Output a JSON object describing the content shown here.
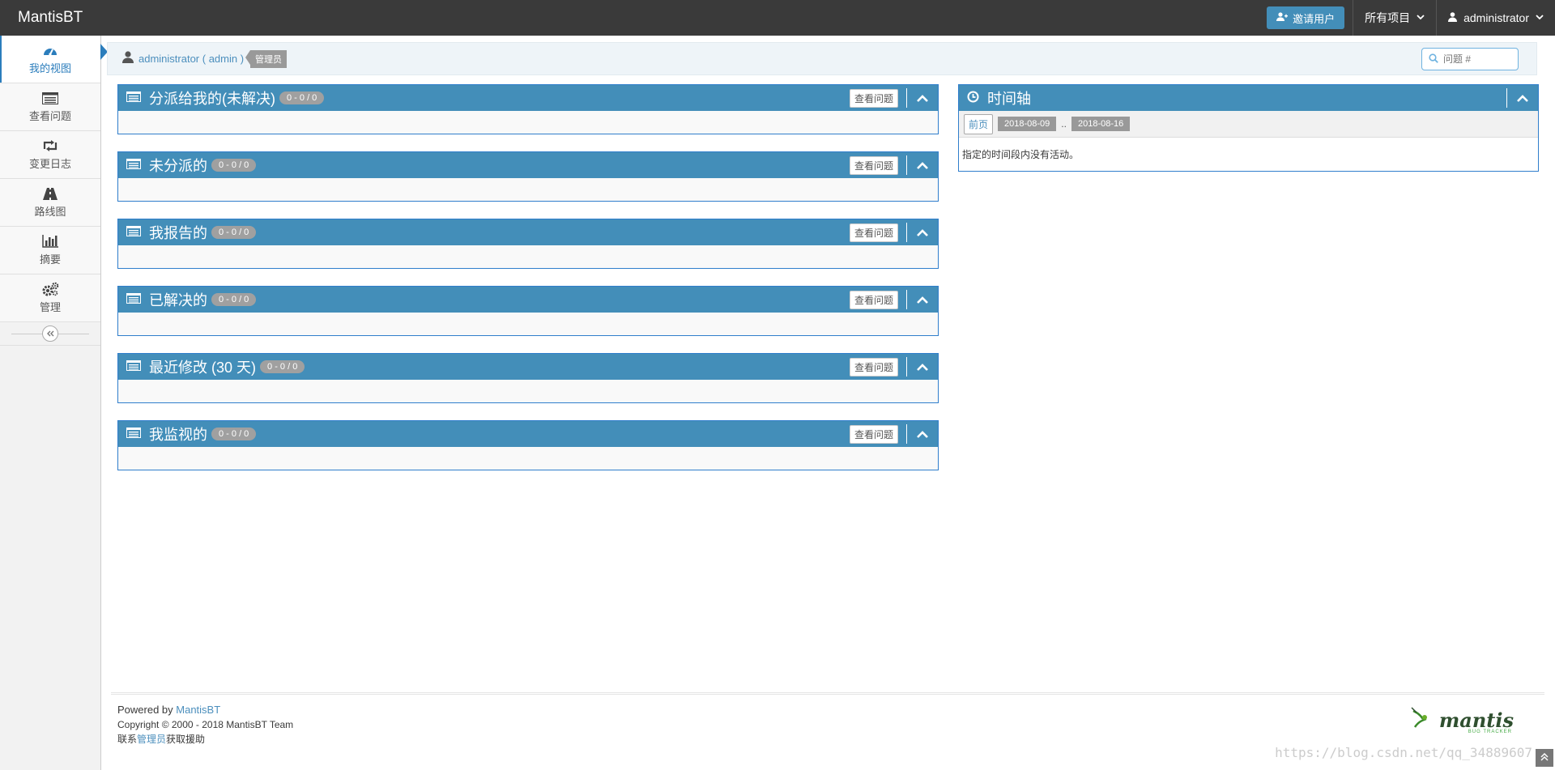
{
  "navbar": {
    "brand": "MantisBT",
    "invite_label": "邀请用户",
    "projects_label": "所有项目",
    "user_label": "administrator"
  },
  "sidebar": {
    "items": [
      {
        "label": "我的视图",
        "icon": "dashboard-icon"
      },
      {
        "label": "查看问题",
        "icon": "list-icon"
      },
      {
        "label": "变更日志",
        "icon": "retweet-icon"
      },
      {
        "label": "路线图",
        "icon": "road-icon"
      },
      {
        "label": "摘要",
        "icon": "bar-chart-icon"
      },
      {
        "label": "管理",
        "icon": "gears-icon"
      }
    ]
  },
  "breadcrumb": {
    "user": "administrator ( admin )",
    "role": "管理员",
    "search_placeholder": "问题 #"
  },
  "widgets": [
    {
      "title": "分派给我的(未解决)",
      "count": "0 - 0 / 0",
      "button": "查看问题"
    },
    {
      "title": "未分派的",
      "count": "0 - 0 / 0",
      "button": "查看问题"
    },
    {
      "title": "我报告的",
      "count": "0 - 0 / 0",
      "button": "查看问题"
    },
    {
      "title": "已解决的",
      "count": "0 - 0 / 0",
      "button": "查看问题"
    },
    {
      "title": "最近修改 (30 天)",
      "count": "0 - 0 / 0",
      "button": "查看问题"
    },
    {
      "title": "我监视的",
      "count": "0 - 0 / 0",
      "button": "查看问题"
    }
  ],
  "timeline": {
    "title": "时间轴",
    "prev_label": "前页",
    "date_from": "2018-08-09",
    "separator": "..",
    "date_to": "2018-08-16",
    "message": "指定的时间段内没有活动。"
  },
  "footer": {
    "powered_prefix": "Powered by ",
    "powered_link": "MantisBT",
    "copyright": "Copyright © 2000 - 2018 MantisBT Team",
    "contact_prefix": "联系",
    "contact_link": "管理员",
    "contact_suffix": "获取援助",
    "logo_text": "mantis",
    "logo_sub": "BUG TRACKER"
  },
  "watermark": "https://blog.csdn.net/qq_34889607"
}
